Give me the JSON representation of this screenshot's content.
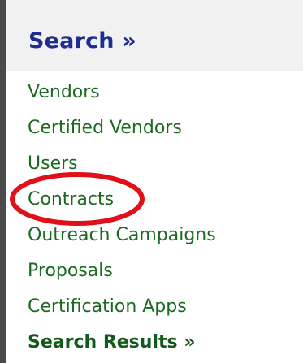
{
  "header": {
    "title": "Search »"
  },
  "menu": {
    "items": [
      {
        "label": "Vendors"
      },
      {
        "label": "Certified Vendors"
      },
      {
        "label": "Users"
      },
      {
        "label": "Contracts"
      },
      {
        "label": "Outreach Campaigns"
      },
      {
        "label": "Proposals"
      },
      {
        "label": "Certification Apps"
      },
      {
        "label": "Search Results »"
      }
    ]
  },
  "colors": {
    "header_text": "#1f2d8f",
    "link_text": "#1c6a22",
    "annotation_circle": "#e0101a",
    "header_background": "#f1f1f1"
  },
  "annotation": {
    "shape": "ellipse",
    "highlights": "Contracts"
  }
}
